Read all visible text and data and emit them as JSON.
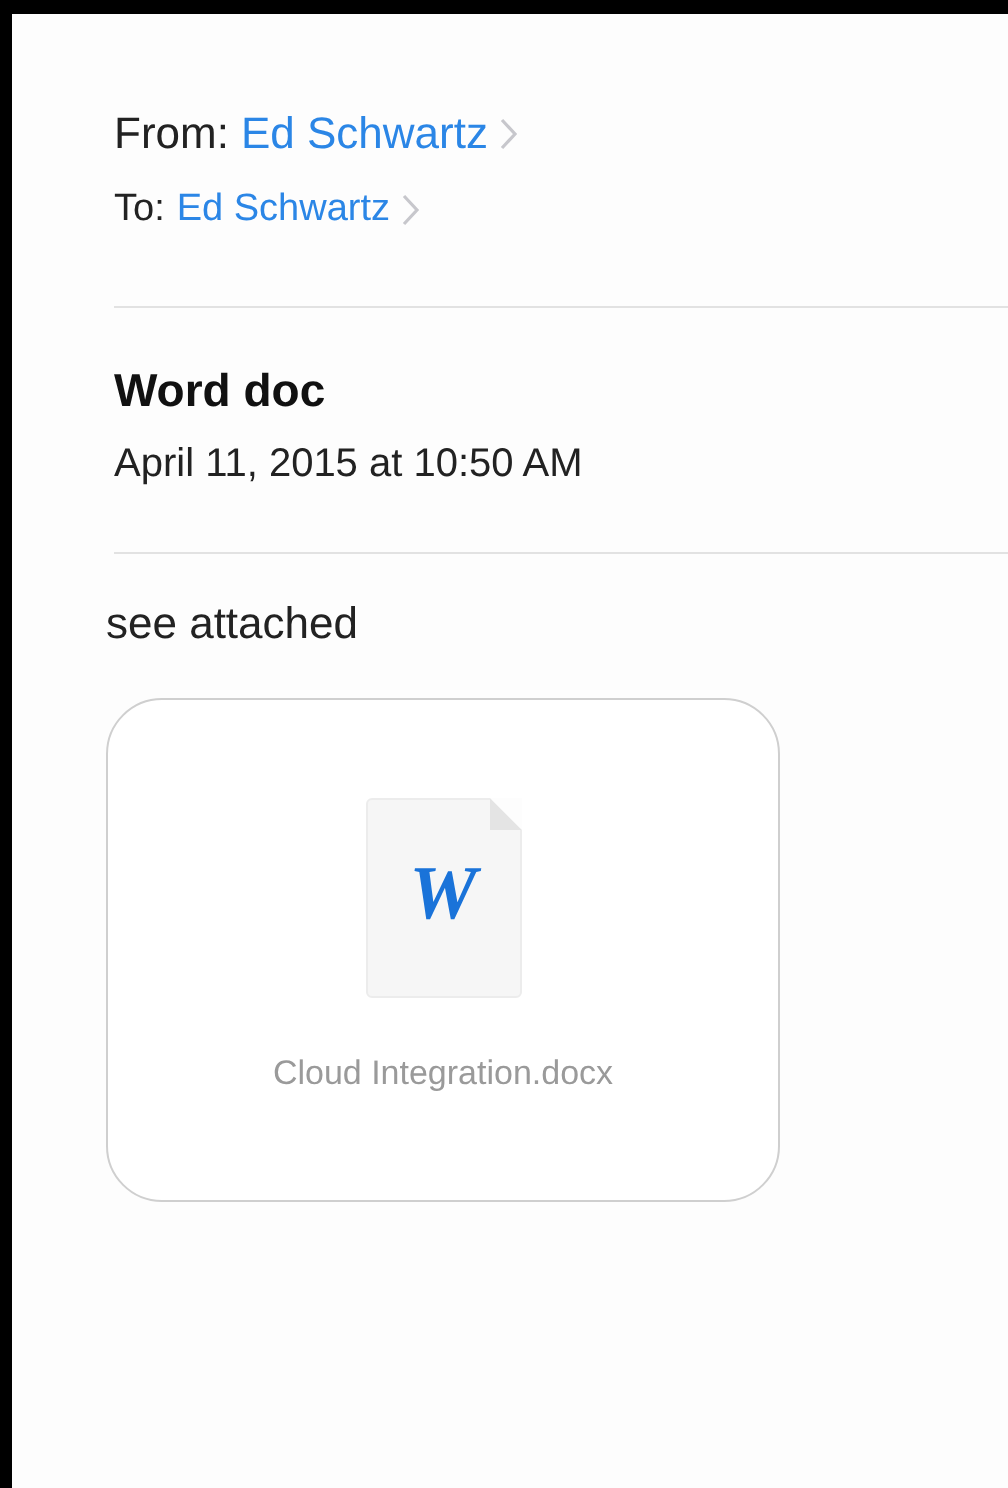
{
  "header": {
    "from": {
      "label": "From:",
      "name": "Ed Schwartz"
    },
    "to": {
      "label": "To:",
      "name": "Ed Schwartz"
    }
  },
  "message": {
    "subject": "Word doc",
    "date": "April 11, 2015 at 10:50 AM",
    "body": "see attached"
  },
  "attachment": {
    "icon_letter": "W",
    "filename": "Cloud Integration.docx"
  }
}
